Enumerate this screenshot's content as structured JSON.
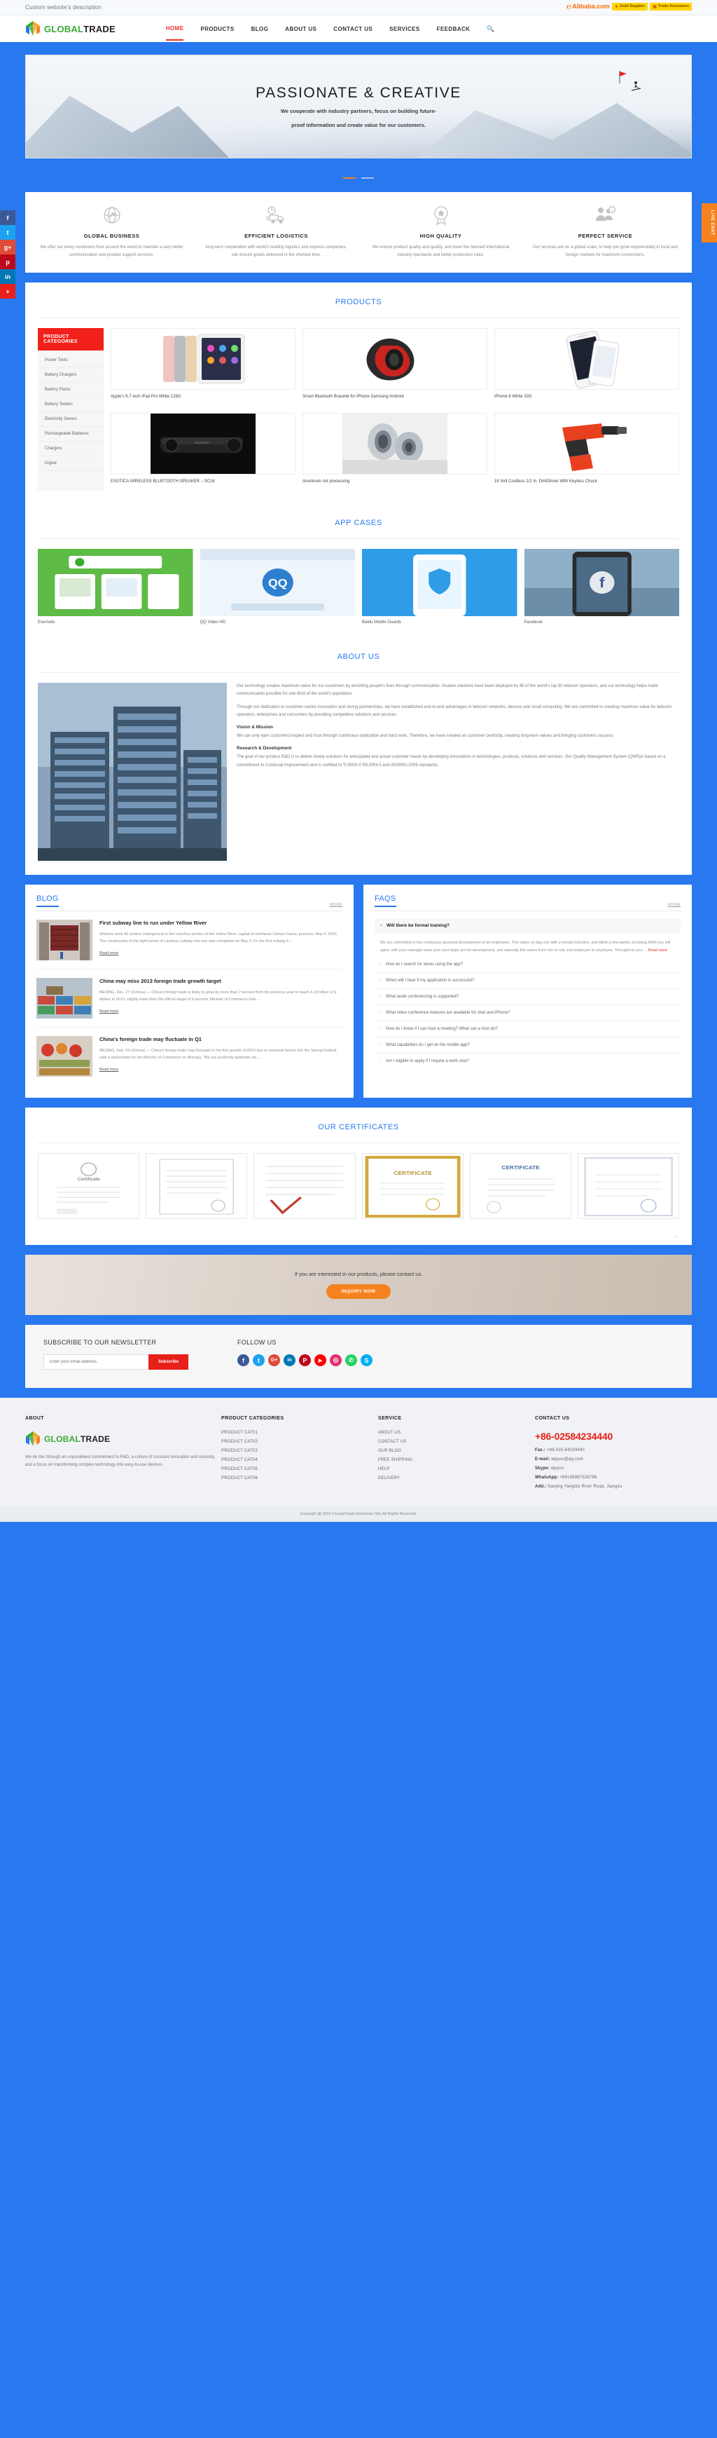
{
  "topbar": {
    "description": "Custom website's description",
    "alibaba": "Alibaba.com",
    "gold_supplier": "Gold Supplier",
    "trade_assurance": "Trade Assurance"
  },
  "brand": {
    "part1": "GLOBAL",
    "part2": "TRADE"
  },
  "nav": {
    "items": [
      {
        "label": "HOME",
        "active": true
      },
      {
        "label": "PRODUCTS",
        "active": false
      },
      {
        "label": "BLOG",
        "active": false
      },
      {
        "label": "ABOUT US",
        "active": false
      },
      {
        "label": "CONTACT US",
        "active": false
      },
      {
        "label": "SERVICES",
        "active": false
      },
      {
        "label": "FEEDBACK",
        "active": false
      }
    ],
    "search_icon": "search-icon"
  },
  "hero": {
    "title": "PASSIONATE  &  CREATIVE",
    "line1": "We cooperate with industry partners, focus on building future-",
    "line2": "proof information and create value for our customers."
  },
  "side_social": [
    "f",
    "t",
    "g+",
    "p",
    "in",
    "+"
  ],
  "live_chat": "LIVE CHAT",
  "features": [
    {
      "icon": "globe-icon",
      "title": "GLOBAL BUSINESS",
      "text": "We offer our every customers from around the world to maintain a very better communication and product support services."
    },
    {
      "icon": "truck-icon",
      "title": "EFFICIENT LOGISTICS",
      "text": "long-term cooperation with world's leading logistics and express companies, can ensure goods delivered in the shortest time."
    },
    {
      "icon": "star-shield-icon",
      "title": "HIGH QUALITY",
      "text": "We ensure product quality and quality, and meet the relevant international industry standards and better production rules."
    },
    {
      "icon": "people-info-icon",
      "title": "PERFECT SERVICE",
      "text": "Our services are on a global scale, to help you grow exponentially in local and foreign markets for maximum conversions."
    }
  ],
  "products": {
    "heading": "PRODUCTS",
    "categories_title": "PRODUCT CATEGORIES",
    "categories": [
      "Power Tools",
      "Battery Chargers",
      "Battery Packs",
      "Battery Testers",
      "Electricity Savers",
      "Rechargeable Batteries",
      "Chargers",
      "Digital"
    ],
    "items": [
      {
        "name": "Apple's 9.7-inch iPad Pro White 128G",
        "image": "ipad-pro"
      },
      {
        "name": "Smart Bluetooth Bracelet for iPhone Samsung Android",
        "image": "bluetooth-bracelet"
      },
      {
        "name": "iPhone 6 White 32G",
        "image": "iphone-6-white"
      },
      {
        "name": "ESOTICA WIRELESS BLUETOOTH SPEAKER – SC16",
        "image": "bluetooth-speaker"
      },
      {
        "name": "Aluminum nut processing",
        "image": "aluminum-nut"
      },
      {
        "name": "18 Volt Cordless 1/2 In. Drill/Driver With Keyless Chuck",
        "image": "cordless-drill"
      }
    ]
  },
  "app_cases": {
    "heading": "APP CASES",
    "items": [
      {
        "name": "Evernote",
        "image": "evernote-case"
      },
      {
        "name": "QQ Video HD",
        "image": "qq-video-case"
      },
      {
        "name": "Baidu Mobile Guards",
        "image": "baidu-guards-case"
      },
      {
        "name": "Facebook",
        "image": "facebook-case"
      }
    ]
  },
  "about": {
    "heading": "ABOUT US",
    "image": "office-building-photo",
    "p1": "Our technology creates maximum value for our customers by enriching people's lives through communication. Huawei solutions have been deployed by 45 of the world's top 50 telecom operators, and our technology helps make communication possible for one-third of the world's population.",
    "p2": "Through our dedication to customer-centric innovation and strong partnerships, we have established end-to-end advantages in telecom networks, devices and cloud computing. We are committed to creating maximum value for telecom operators, enterprises and consumers by providing competitive solutions and services.",
    "h1": "Vision & Mission",
    "p3": "We can only earn customers'respect and trust through continuous dedication and hard work. Therefore, we have created an customer centricity, creating long-term values and bringing customers success.",
    "h2": "Research & Development",
    "p4": "The goal of our product R&D is to deliver timely solutions for anticipated and actual customer needs by developing innovations in technologies, products, solutions and services. Our Quality Management System (QMS)is based on a commitment to Continual Improvement and is certified to TL9000-V R5.0/R4.5 and ISO9001:2008 standards."
  },
  "blog": {
    "heading": "BLOG",
    "more": "MORE",
    "read_more": "Read more",
    "posts": [
      {
        "title": "First subway line to run under Yellow River",
        "image": "subway-tunnel-photo",
        "excerpt": "Workers work 40 meters underground in the Lanzhou section of the Yellow River, capital of northwest China's Gansu province, May 9, 2016. The construction of the right tunnel of Lanzhou subway line one was completed on May 9. It's the first subway li ..."
      },
      {
        "title": "China may miss 2013 foreign trade growth target",
        "image": "shipping-containers-photo",
        "excerpt": "BEIJING, Dec. 27 (Xinhua) — China's foreign trade is likely to grow by more than 7 percent from the previous year to reach 4.19 trillion U.S. dollars in 2013, slightly lower than the official target of 8 percent, Minister of Commerce Gao ..."
      },
      {
        "title": "China's foreign trade may fluctuate in Q1",
        "image": "market-produce-photo",
        "excerpt": "BEIJING, Feb. 24 (Xinhua) — China's foreign trade may fluctuate in the first quarter of 2014 due to seasonal factors like the Spring Festival, said a spokesman for the Ministry of Commerce on Monday. \"We are prudently optimistic ab ..."
      }
    ]
  },
  "faqs": {
    "heading": "FAQS",
    "more": "MORE",
    "open_question": "Will there be formal training?",
    "open_answer": "We are committed to the continuous personal development of all employees. This starts on day one with a formal induction, and within a few weeks of joining ARM you will agree with your manager what your next steps are for development, and naturally this varies from role to role and employee to employee. Throughout your ...",
    "read_more": "Read more",
    "questions": [
      "How do I search for wines using the app?",
      "When will I hear if my application is successful?",
      "What audio conferencing is supported?",
      "What video conference features are available for chat and iPhone?",
      "How do I know if I can host a meeting? What can a host do?",
      "What capabilities do I get on the mobile app?",
      "Am I eligible to apply if I require a work visa?"
    ]
  },
  "certificates": {
    "heading": "OUR CERTIFICATES",
    "items": [
      "certificate-1",
      "certificate-2",
      "certificate-3",
      "certificate-4",
      "certificate-5",
      "certificate-6"
    ],
    "prev_icon": "chevron-left-icon",
    "next_icon": "chevron-right-icon"
  },
  "cta": {
    "text": "If you are interested in our products, please contact us.",
    "button": "INQUIRY NOW"
  },
  "newsletter": {
    "title": "SUBSCRIBE TO OUR NEWSLETTER",
    "placeholder": "Enter your email address.",
    "value": "",
    "button": "Subscribe",
    "follow_title": "FOLLOW US",
    "socials": [
      {
        "name": "facebook",
        "glyph": "f",
        "color": "#3b5998"
      },
      {
        "name": "twitter",
        "glyph": "t",
        "color": "#1da1f2"
      },
      {
        "name": "google-plus",
        "glyph": "G+",
        "color": "#dd4b39"
      },
      {
        "name": "linkedin",
        "glyph": "in",
        "color": "#0077b5"
      },
      {
        "name": "pinterest",
        "glyph": "P",
        "color": "#bd081c"
      },
      {
        "name": "youtube",
        "glyph": "▶",
        "color": "#ff0000"
      },
      {
        "name": "instagram",
        "glyph": "◎",
        "color": "#e1306c"
      },
      {
        "name": "whatsapp",
        "glyph": "✆",
        "color": "#25d366"
      },
      {
        "name": "skype",
        "glyph": "S",
        "color": "#00aff0"
      }
    ]
  },
  "footer": {
    "about": {
      "title": "ABOUT",
      "text": "We do this through an unparalleled commitment to R&D, a culture of constant innovation and curiosity, and a focus on transforming complex technology into easy-to-use devices."
    },
    "categories": {
      "title": "PRODUCT CATEGORIES",
      "items": [
        "PRODUCT CAT01",
        "PRODUCT CAT02",
        "PRODUCT CAT03",
        "PRODUCT CAT04",
        "PRODUCT CAT05",
        "PRODUCT CAT06"
      ]
    },
    "service": {
      "title": "SERVICE",
      "items": [
        "ABOUT US",
        "CONTACT US",
        "OUR BLOG",
        "FREE SHIPPING",
        "HELP",
        "DELIVERY"
      ]
    },
    "contact": {
      "title": "CONTACT US",
      "phone": "+86-02584234440",
      "fax_label": "Fax.:",
      "fax": "+86-025-84234440",
      "email_label": "E-mail:",
      "email": "wpyou@qq.com",
      "skype_label": "Skype:",
      "skype": "wpyou",
      "whatsapp_label": "WhatsApp:",
      "whatsapp": "+86136987528786",
      "add_label": "Add.:",
      "address": "Nanjing Yangtze River Road, Jiangsu"
    },
    "copyright": "Copyright @ 2015 ForeignTrade Enterprise Site All Rights Reserved."
  }
}
